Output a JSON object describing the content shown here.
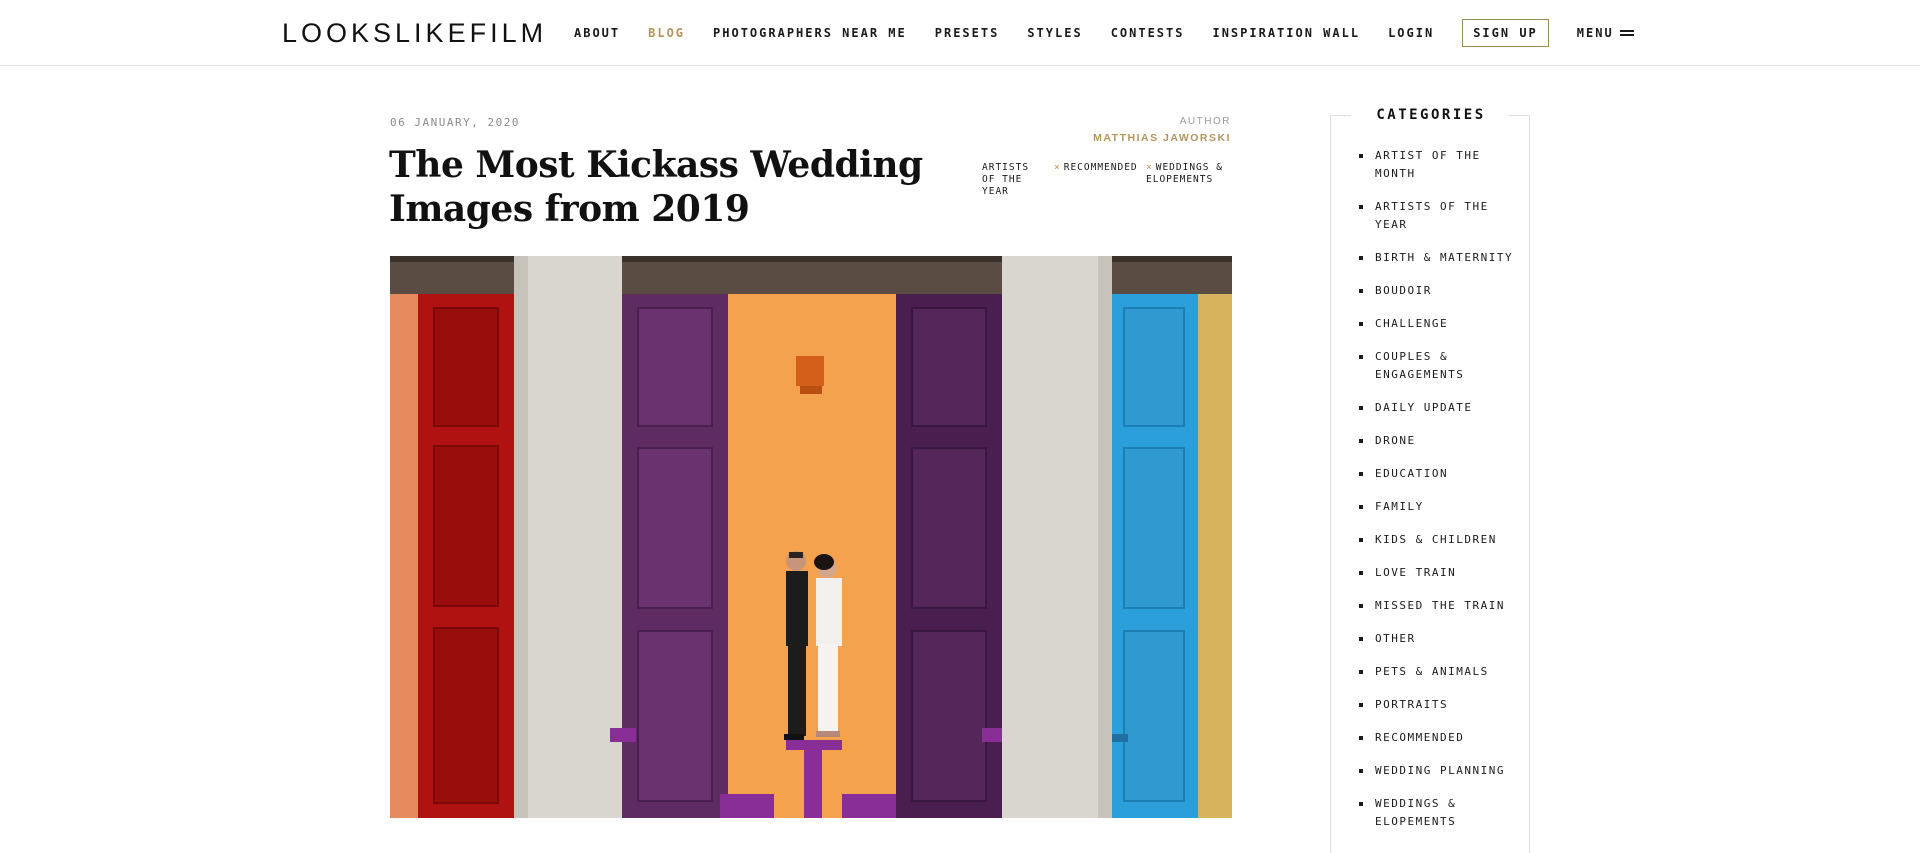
{
  "header": {
    "logo": "LOOKSLIKEFILM",
    "nav": [
      {
        "label": "ABOUT",
        "active": false
      },
      {
        "label": "BLOG",
        "active": true
      },
      {
        "label": "PHOTOGRAPHERS NEAR ME",
        "active": false
      },
      {
        "label": "PRESETS",
        "active": false
      },
      {
        "label": "STYLES",
        "active": false
      },
      {
        "label": "CONTESTS",
        "active": false
      },
      {
        "label": "INSPIRATION WALL",
        "active": false
      },
      {
        "label": "LOGIN",
        "active": false
      }
    ],
    "signup_label": "SIGN UP",
    "menu_label": "MENU",
    "menu_icon": "hamburger-icon",
    "accent_color": "#b4945d"
  },
  "post": {
    "date": "06 JANUARY, 2020",
    "author_label": "AUTHOR",
    "author_name": "MATTHIAS JAWORSKI",
    "title": "The Most Kickass Wedding Images from 2019",
    "tags": [
      {
        "label": "ARTISTS OF THE YEAR"
      },
      {
        "label": "RECOMMENDED",
        "icon": "×"
      },
      {
        "label": "WEDDINGS & ELOPEMENTS",
        "icon": "×"
      }
    ]
  },
  "sidebar": {
    "title": "CATEGORIES",
    "categories": [
      "ARTIST OF THE MONTH",
      "ARTISTS OF THE YEAR",
      "BIRTH & MATERNITY",
      "BOUDOIR",
      "CHALLENGE",
      "COUPLES & ENGAGEMENTS",
      "DAILY UPDATE",
      "DRONE",
      "EDUCATION",
      "FAMILY",
      "KIDS & CHILDREN",
      "LOVE TRAIN",
      "MISSED THE TRAIN",
      "OTHER",
      "PETS & ANIMALS",
      "PORTRAITS",
      "RECOMMENDED",
      "WEDDING PLANNING",
      "WEDDINGS & ELOPEMENTS"
    ]
  }
}
